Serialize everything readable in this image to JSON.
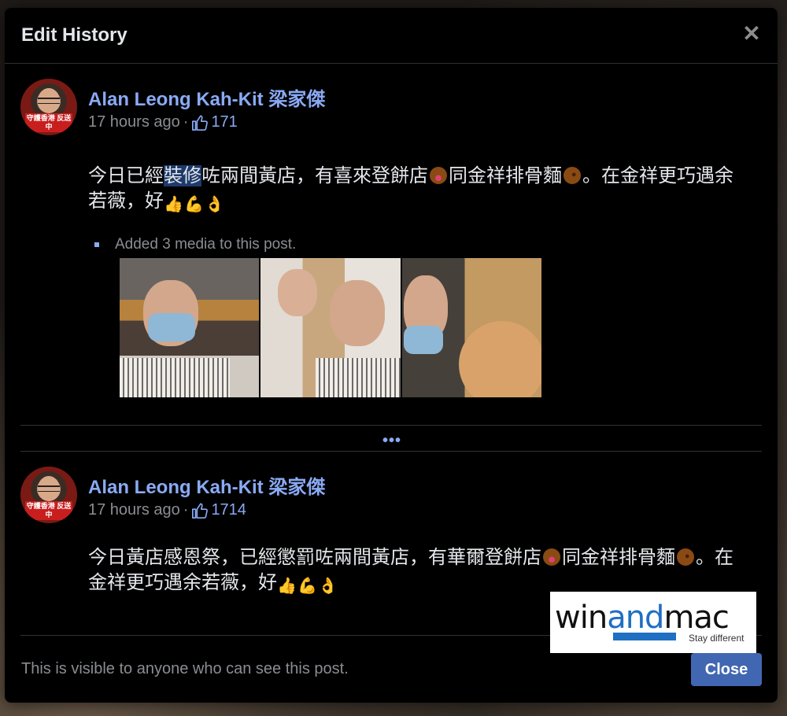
{
  "modal": {
    "title": "Edit History",
    "close_icon": "✕",
    "footer_text": "This is visible to anyone who can see this post.",
    "close_button": "Close"
  },
  "revisions": [
    {
      "author": "Alan Leong Kah-Kit 梁家傑",
      "time": "17 hours ago",
      "separator": "·",
      "likes": "171",
      "avatar_badge": "守護香港 反送中",
      "text_before": "今日已經",
      "text_highlight": "裝修",
      "text_after": "咗兩間黃店，有喜來登餅店",
      "text_mid": "同金祥排骨麵",
      "text_end": "。在金祥更巧遇余若薇，好",
      "media_note": "Added 3 media to this post."
    },
    {
      "author": "Alan Leong Kah-Kit 梁家傑",
      "time": "17 hours ago",
      "separator": "·",
      "likes": "1714",
      "avatar_badge": "守護香港 反送中",
      "text_a": "今日黃店感恩祭，已經懲罰咗兩間黃店，有華爾登餅店",
      "text_b": "同金祥排骨麵",
      "text_c": "。在金祥更巧遇余若薇，好"
    }
  ],
  "ellipsis": "•••",
  "icons": {
    "like": "thumbs-up-icon",
    "close": "close-icon",
    "emoji_yum": "face-savoring-food-emoji",
    "emoji_wink": "winking-face-emoji",
    "emoji_thumb": "thumbs-up-emoji",
    "emoji_muscle": "flexed-biceps-emoji",
    "emoji_ok": "ok-hand-emoji"
  },
  "watermark": {
    "win": "win",
    "and": "and",
    "mac": "mac",
    "tagline": "Stay different"
  },
  "colors": {
    "accent": "#8aaaf5",
    "button": "#4267b2",
    "modal_bg": "#000000"
  }
}
